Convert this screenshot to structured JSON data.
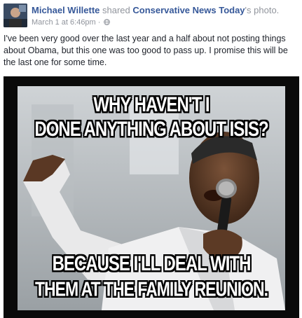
{
  "post": {
    "author_name": "Michael Willette",
    "shared_word": " shared ",
    "source_name": "Conservative News Today",
    "photo_suffix": "'s photo.",
    "timestamp": "March 1 at 6:46pm",
    "separator": " · ",
    "privacy_icon": "globe-icon",
    "body_text": "I've been very good over the last year and a half about not posting things about Obama, but this one was too good to pass up. I promise this will be the last one for some time."
  },
  "meme": {
    "top_line_1": "WHY HAVEN'T I",
    "top_line_2": "DONE ANYTHING ABOUT ISIS?",
    "bottom_line_1": "BECAUSE I'LL DEAL WITH",
    "bottom_line_2": "THEM AT THE FAMILY REUNION."
  },
  "colors": {
    "link": "#365899",
    "meta": "#90949c",
    "text": "#1d2129"
  }
}
